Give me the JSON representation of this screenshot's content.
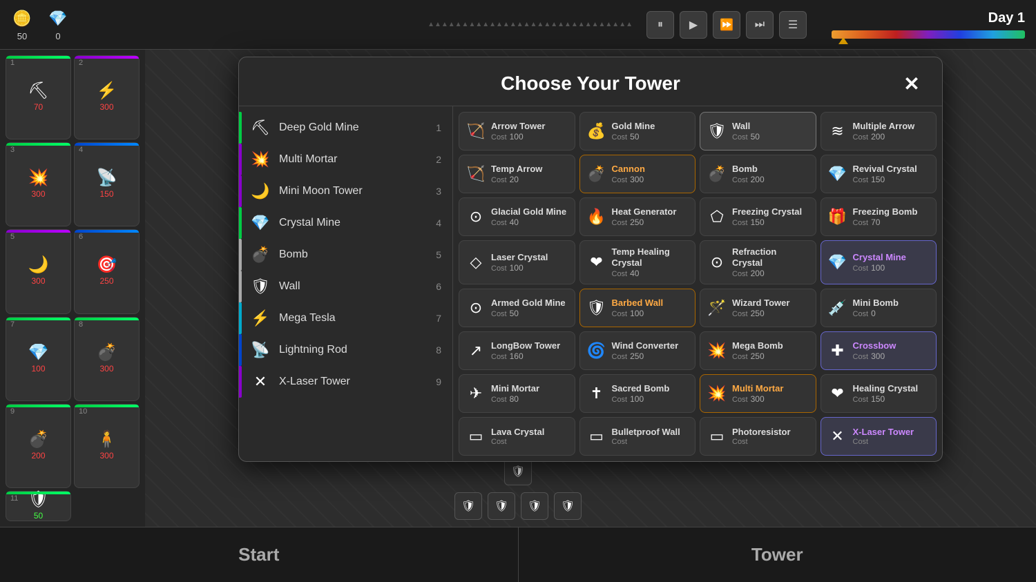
{
  "topbar": {
    "gold_value": "50",
    "crystal_value": "0",
    "day_label": "Day 1",
    "controls": [
      "⏸",
      "▶",
      "⏩",
      "⏭",
      "☰"
    ]
  },
  "sidebar_slots": [
    {
      "num": "1",
      "icon": "⛏",
      "cost": "70",
      "cost_color": "red",
      "bar": "green"
    },
    {
      "num": "2",
      "icon": "⚡",
      "cost": "300",
      "cost_color": "red",
      "bar": "purple"
    },
    {
      "num": "3",
      "icon": "💥",
      "cost": "300",
      "cost_color": "red",
      "bar": "green"
    },
    {
      "num": "4",
      "icon": "📡",
      "cost": "150",
      "cost_color": "red",
      "bar": "blue"
    },
    {
      "num": "5",
      "icon": "🌙",
      "cost": "300",
      "cost_color": "red",
      "bar": "purple"
    },
    {
      "num": "6",
      "icon": "🎯",
      "cost": "250",
      "cost_color": "red",
      "bar": "blue"
    },
    {
      "num": "7",
      "icon": "💎",
      "cost": "100",
      "cost_color": "red",
      "bar": "green"
    },
    {
      "num": "8",
      "icon": "💣",
      "cost": "300",
      "cost_color": "red",
      "bar": "green"
    },
    {
      "num": "9",
      "icon": "💣",
      "cost": "200",
      "cost_color": "red",
      "bar": "green"
    },
    {
      "num": "10",
      "icon": "🧍",
      "cost": "300",
      "cost_color": "red",
      "bar": "green"
    },
    {
      "num": "11",
      "icon": "🛡",
      "cost": "50",
      "cost_color": "green",
      "bar": "green"
    }
  ],
  "modal": {
    "title": "Choose Your Tower",
    "close_label": "✕",
    "list_items": [
      {
        "name": "Deep Gold Mine",
        "num": "1",
        "indicator": "green",
        "icon": "⛏"
      },
      {
        "name": "Multi Mortar",
        "num": "2",
        "indicator": "purple",
        "icon": "💥"
      },
      {
        "name": "Mini Moon Tower",
        "num": "3",
        "indicator": "purple",
        "icon": "🌙"
      },
      {
        "name": "Crystal Mine",
        "num": "4",
        "indicator": "green",
        "icon": "💎"
      },
      {
        "name": "Bomb",
        "num": "5",
        "indicator": "white",
        "icon": "💣"
      },
      {
        "name": "Wall",
        "num": "6",
        "indicator": "white",
        "icon": "🛡"
      },
      {
        "name": "Mega Tesla",
        "num": "7",
        "indicator": "cyan",
        "icon": "⚡"
      },
      {
        "name": "Lightning Rod",
        "num": "8",
        "indicator": "blue",
        "icon": "📡"
      },
      {
        "name": "X-Laser Tower",
        "num": "9",
        "indicator": "purple",
        "icon": "✕"
      }
    ],
    "grid_items": [
      {
        "name": "Arrow Tower",
        "cost": "100",
        "icon": "🏹",
        "highlight": false
      },
      {
        "name": "Gold Mine",
        "cost": "50",
        "icon": "💰",
        "highlight": false
      },
      {
        "name": "Wall",
        "cost": "50",
        "icon": "🛡",
        "highlight": false,
        "selected": true
      },
      {
        "name": "Multiple Arrow",
        "cost": "200",
        "icon": "≋",
        "highlight": false
      },
      {
        "name": "Temp Arrow",
        "cost": "20",
        "icon": "🏹",
        "highlight": false
      },
      {
        "name": "Cannon",
        "cost": "300",
        "icon": "💣",
        "highlight": true
      },
      {
        "name": "Bomb",
        "cost": "200",
        "icon": "💣",
        "highlight": false
      },
      {
        "name": "Revival Crystal",
        "cost": "150",
        "icon": "💎",
        "highlight": false
      },
      {
        "name": "Glacial Gold Mine",
        "cost": "40",
        "icon": "⊙",
        "highlight": false
      },
      {
        "name": "Heat Generator",
        "cost": "250",
        "icon": "🔥",
        "highlight": false
      },
      {
        "name": "Freezing Crystal",
        "cost": "150",
        "icon": "⬠",
        "highlight": false
      },
      {
        "name": "Freezing Bomb",
        "cost": "70",
        "icon": "🎁",
        "highlight": false
      },
      {
        "name": "Laser Crystal",
        "cost": "100",
        "icon": "◇",
        "highlight": false
      },
      {
        "name": "Temp Healing Crystal",
        "cost": "40",
        "icon": "❤",
        "highlight": false
      },
      {
        "name": "Refraction Crystal",
        "cost": "200",
        "icon": "⊙",
        "highlight": false
      },
      {
        "name": "Crystal Mine",
        "cost": "100",
        "icon": "💎",
        "highlight": false,
        "selected": true
      },
      {
        "name": "Armed Gold Mine",
        "cost": "50",
        "icon": "⊙",
        "highlight": false
      },
      {
        "name": "Barbed Wall",
        "cost": "100",
        "icon": "🛡",
        "highlight": true
      },
      {
        "name": "Wizard Tower",
        "cost": "250",
        "icon": "🪄",
        "highlight": false
      },
      {
        "name": "Mini Bomb",
        "cost": "0",
        "icon": "💉",
        "highlight": false
      },
      {
        "name": "LongBow Tower",
        "cost": "160",
        "icon": "↗",
        "highlight": false
      },
      {
        "name": "Wind Converter",
        "cost": "250",
        "icon": "🌀",
        "highlight": false
      },
      {
        "name": "Mega Bomb",
        "cost": "250",
        "icon": "💥",
        "highlight": false
      },
      {
        "name": "Crossbow",
        "cost": "300",
        "icon": "✚",
        "highlight": false,
        "selected": true
      },
      {
        "name": "Mini Mortar",
        "cost": "80",
        "icon": "✈",
        "highlight": false
      },
      {
        "name": "Sacred Bomb",
        "cost": "100",
        "icon": "✝",
        "highlight": false
      },
      {
        "name": "Multi Mortar",
        "cost": "300",
        "icon": "💥",
        "highlight": true
      },
      {
        "name": "Healing Crystal",
        "cost": "150",
        "icon": "❤",
        "highlight": false
      },
      {
        "name": "Lava Crystal",
        "cost": "",
        "icon": "▭",
        "highlight": false
      },
      {
        "name": "Bulletproof Wall",
        "cost": "",
        "icon": "▭",
        "highlight": false
      },
      {
        "name": "Photoresistor",
        "cost": "",
        "icon": "▭",
        "highlight": false
      },
      {
        "name": "X-Laser Tower",
        "cost": "",
        "icon": "✕",
        "highlight": false,
        "selected": true
      }
    ]
  },
  "bottom": {
    "start_label": "Start",
    "tower_label": "Tower"
  },
  "bottom_icons": [
    "🛡",
    "🛡",
    "🛡",
    "🛡"
  ],
  "bottom_icon_top": "🛡"
}
